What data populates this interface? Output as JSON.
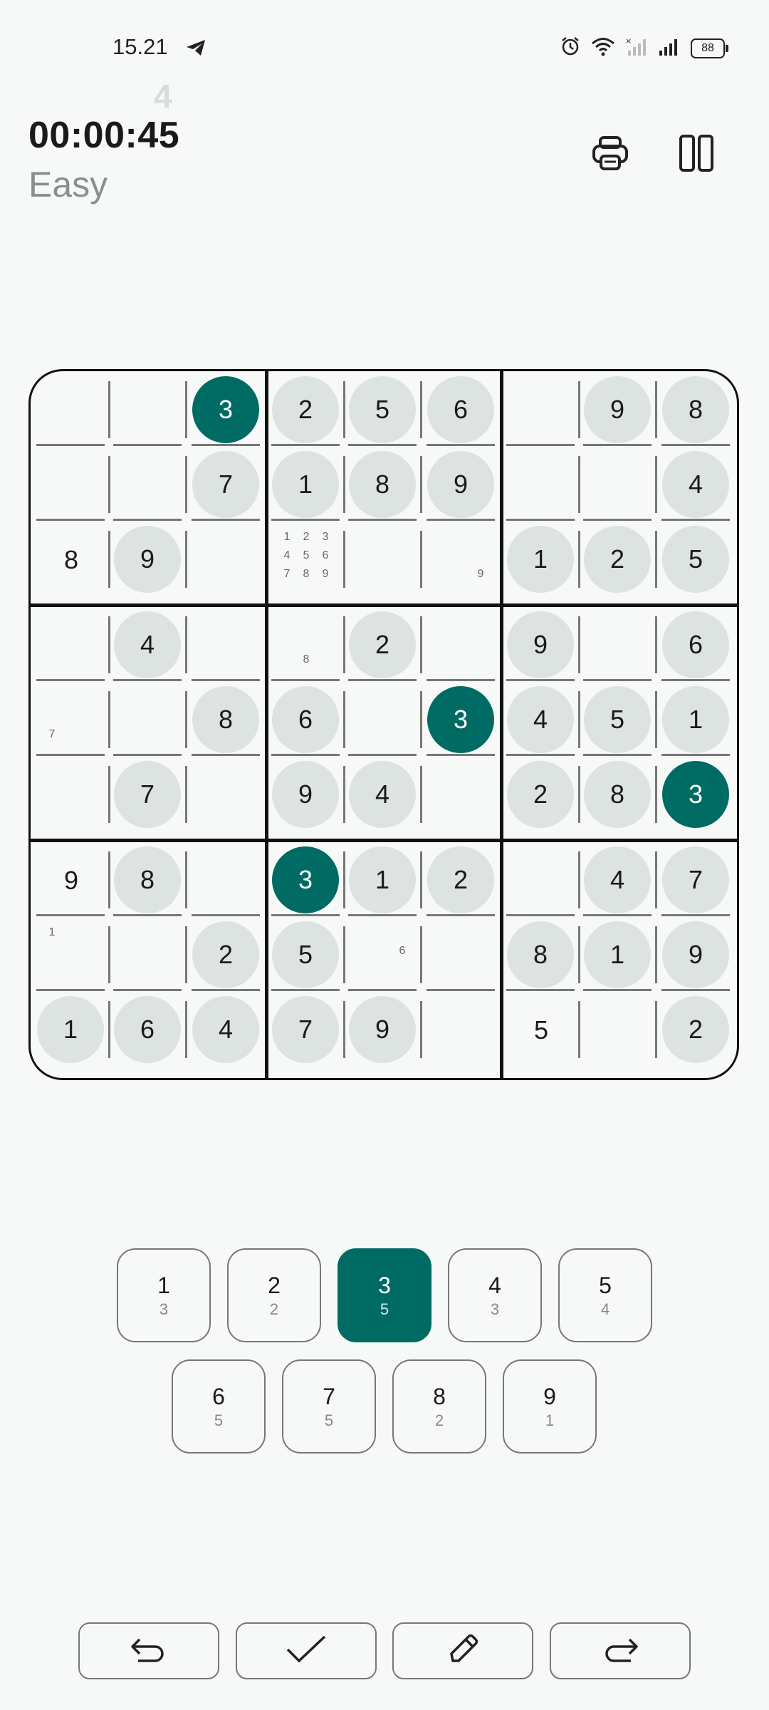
{
  "status_bar": {
    "time": "15.21",
    "battery": "88",
    "icons": [
      "telegram-icon",
      "alarm-icon",
      "wifi-icon",
      "signal-muted-icon",
      "signal-icon",
      "battery-icon"
    ]
  },
  "header": {
    "timer": "00:00:45",
    "timer_previous_digit": "4",
    "difficulty": "Easy",
    "print_icon": "printer-icon",
    "pause_icon": "pause-icon"
  },
  "board": {
    "selected_digit": 3,
    "cells": [
      [
        {
          "v": ""
        },
        {
          "v": ""
        },
        {
          "v": "3",
          "filled": true
        },
        {
          "v": "2",
          "filled": true
        },
        {
          "v": "5",
          "filled": true
        },
        {
          "v": "6",
          "filled": true
        },
        {
          "v": ""
        },
        {
          "v": "9",
          "filled": true
        },
        {
          "v": "8",
          "filled": true
        }
      ],
      [
        {
          "v": ""
        },
        {
          "v": ""
        },
        {
          "v": "7",
          "filled": true
        },
        {
          "v": "1",
          "filled": true
        },
        {
          "v": "8",
          "filled": true
        },
        {
          "v": "9",
          "filled": true
        },
        {
          "v": ""
        },
        {
          "v": ""
        },
        {
          "v": "4",
          "filled": true
        }
      ],
      [
        {
          "v": "8",
          "filled": false
        },
        {
          "v": "9",
          "filled": true
        },
        {
          "v": ""
        },
        {
          "v": "",
          "notes": [
            "1",
            "2",
            "3",
            "4",
            "5",
            "6",
            "7",
            "8",
            "9"
          ]
        },
        {
          "v": ""
        },
        {
          "v": "",
          "notes": [
            "9"
          ]
        },
        {
          "v": "1",
          "filled": true
        },
        {
          "v": "2",
          "filled": true
        },
        {
          "v": "5",
          "filled": true
        }
      ],
      [
        {
          "v": ""
        },
        {
          "v": "4",
          "filled": true
        },
        {
          "v": ""
        },
        {
          "v": "",
          "notes": [
            "8"
          ]
        },
        {
          "v": "2",
          "filled": true
        },
        {
          "v": ""
        },
        {
          "v": "9",
          "filled": true
        },
        {
          "v": ""
        },
        {
          "v": "6",
          "filled": true
        }
      ],
      [
        {
          "v": "",
          "notes": [
            "7"
          ]
        },
        {
          "v": ""
        },
        {
          "v": "8",
          "filled": true
        },
        {
          "v": "6",
          "filled": true
        },
        {
          "v": ""
        },
        {
          "v": "3",
          "filled": true
        },
        {
          "v": "4",
          "filled": true
        },
        {
          "v": "5",
          "filled": true
        },
        {
          "v": "1",
          "filled": true
        }
      ],
      [
        {
          "v": ""
        },
        {
          "v": "7",
          "filled": true
        },
        {
          "v": ""
        },
        {
          "v": "9",
          "filled": true
        },
        {
          "v": "4",
          "filled": true
        },
        {
          "v": ""
        },
        {
          "v": "2",
          "filled": true
        },
        {
          "v": "8",
          "filled": true
        },
        {
          "v": "3",
          "filled": true
        }
      ],
      [
        {
          "v": "9",
          "filled": false
        },
        {
          "v": "8",
          "filled": true
        },
        {
          "v": ""
        },
        {
          "v": "3",
          "filled": true
        },
        {
          "v": "1",
          "filled": true
        },
        {
          "v": "2",
          "filled": true
        },
        {
          "v": ""
        },
        {
          "v": "4",
          "filled": true
        },
        {
          "v": "7",
          "filled": true
        }
      ],
      [
        {
          "v": "",
          "notes": [
            "1"
          ]
        },
        {
          "v": ""
        },
        {
          "v": "2",
          "filled": true
        },
        {
          "v": "5",
          "filled": true
        },
        {
          "v": "",
          "notes": [
            "6"
          ]
        },
        {
          "v": ""
        },
        {
          "v": "8",
          "filled": true
        },
        {
          "v": "1",
          "filled": true
        },
        {
          "v": "9",
          "filled": true
        }
      ],
      [
        {
          "v": "1",
          "filled": true
        },
        {
          "v": "6",
          "filled": true
        },
        {
          "v": "4",
          "filled": true
        },
        {
          "v": "7",
          "filled": true
        },
        {
          "v": "9",
          "filled": true
        },
        {
          "v": ""
        },
        {
          "v": "5",
          "filled": false
        },
        {
          "v": ""
        },
        {
          "v": "2",
          "filled": true
        }
      ]
    ]
  },
  "number_pad": [
    {
      "digit": "1",
      "remaining": "3"
    },
    {
      "digit": "2",
      "remaining": "2"
    },
    {
      "digit": "3",
      "remaining": "5",
      "active": true
    },
    {
      "digit": "4",
      "remaining": "3"
    },
    {
      "digit": "5",
      "remaining": "4"
    },
    {
      "digit": "6",
      "remaining": "5"
    },
    {
      "digit": "7",
      "remaining": "5"
    },
    {
      "digit": "8",
      "remaining": "2"
    },
    {
      "digit": "9",
      "remaining": "1"
    }
  ],
  "toolbar": {
    "undo_icon": "undo-icon",
    "check_icon": "check-icon",
    "pencil_icon": "pencil-icon",
    "redo_icon": "redo-icon"
  },
  "colors": {
    "accent": "#006b63",
    "filled_cell": "#dde3e1",
    "background": "#f7f9f8"
  }
}
